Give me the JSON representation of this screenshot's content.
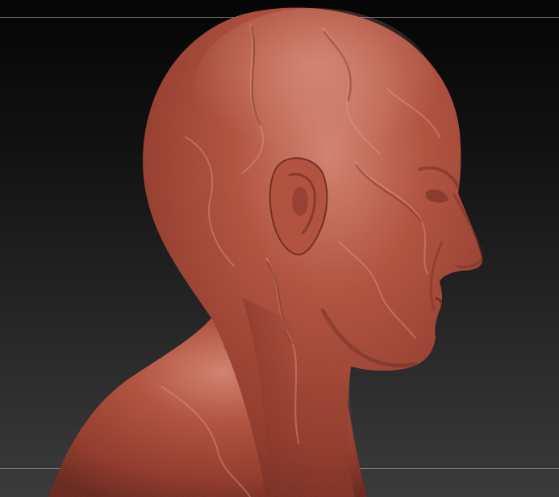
{
  "canvas": {
    "background_top": "#050505",
    "background_bottom": "#3b3b3b",
    "frame_line_color": "#8a8a8a"
  },
  "model": {
    "subject": "sculpted-head-bust-profile",
    "material_base": "#a8483a",
    "material_highlight": "#d98b78",
    "material_shadow": "#5e2119"
  },
  "watermark": {
    "text": ""
  }
}
